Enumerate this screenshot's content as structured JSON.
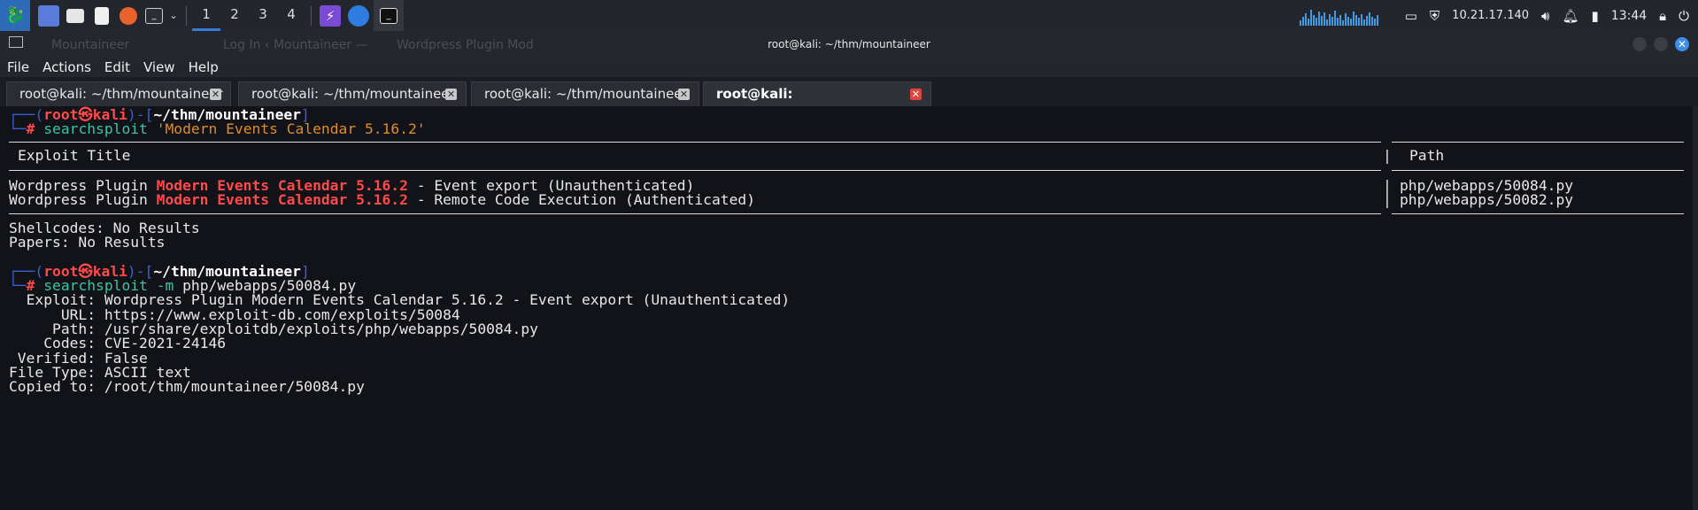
{
  "panel": {
    "workspaces": [
      "1",
      "2",
      "3",
      "4"
    ],
    "ip": "10.21.17.140",
    "clock": "13:44"
  },
  "window": {
    "title": "root@kali: ~/thm/mountaineer",
    "ghost_tabs": [
      "Mountaineer",
      "Log In ‹ Mountaineer —",
      "Wordpress Plugin Mod"
    ]
  },
  "menu": [
    "File",
    "Actions",
    "Edit",
    "View",
    "Help"
  ],
  "tabs": [
    {
      "label": "root@kali: ~/thm/mountaineer"
    },
    {
      "label": "root@kali: ~/thm/mountaineer"
    },
    {
      "label": "root@kali: ~/thm/mountaineer"
    },
    {
      "label": "root@kali: ~/thm/mountaineer"
    }
  ],
  "terminal": {
    "prompt1": {
      "user": "root㉿kali",
      "dir": "~/thm/mountaineer",
      "cmd": "searchsploit",
      "arg": "'Modern Events Calendar 5.16.2'"
    },
    "table": {
      "col_title": "Exploit Title",
      "col_path": "Path",
      "rows": [
        {
          "pre": "Wordpress Plugin ",
          "match": "Modern Events Calendar 5.16.2",
          "post": " - Event export (Unauthenticated)",
          "path": "php/webapps/50084.py"
        },
        {
          "pre": "Wordpress Plugin ",
          "match": "Modern Events Calendar 5.16.2",
          "post": " - Remote Code Execution (Authenticated)",
          "path": "php/webapps/50082.py"
        }
      ]
    },
    "shellcodes": "Shellcodes: No Results",
    "papers": "Papers: No Results",
    "prompt2": {
      "user": "root㉿kali",
      "dir": "~/thm/mountaineer",
      "cmd": "searchsploit",
      "opt": "-m",
      "arg": "php/webapps/50084.py"
    },
    "details": [
      "  Exploit: Wordpress Plugin Modern Events Calendar 5.16.2 - Event export (Unauthenticated)",
      "      URL: https://www.exploit-db.com/exploits/50084",
      "     Path: /usr/share/exploitdb/exploits/php/webapps/50084.py",
      "    Codes: CVE-2021-24146",
      " Verified: False",
      "File Type: ASCII text",
      "Copied to: /root/thm/mountaineer/50084.py"
    ]
  }
}
